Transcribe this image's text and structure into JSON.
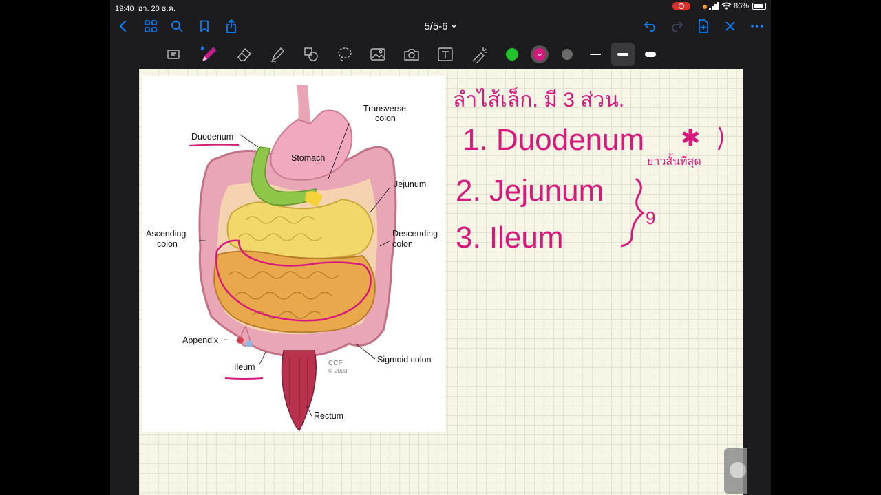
{
  "status_bar": {
    "time": "19:40",
    "date": "อา. 20 ธ.ค.",
    "battery": "86%"
  },
  "nav": {
    "title": "5/5-6",
    "accent": "#0a84ff"
  },
  "toolbar": {
    "icons": [
      "page-view-icon",
      "pen-icon",
      "eraser-icon",
      "highlighter-icon",
      "shapes-icon",
      "lasso-icon",
      "image-icon",
      "camera-icon",
      "text-icon",
      "laser-pointer-icon"
    ],
    "colors": [
      "#22c32a",
      "#d6197a",
      "#6b6b6b"
    ],
    "selected_color": "#d6197a"
  },
  "diagram": {
    "labels": {
      "transverse_colon_1": "Transverse",
      "transverse_colon_2": "colon",
      "duodenum": "Duodenum",
      "stomach": "Stomach",
      "jejunum": "Jejunum",
      "ascending_1": "Ascending",
      "ascending_2": "colon",
      "descending_1": "Descending",
      "descending_2": "colon",
      "appendix": "Appendix",
      "ileum": "Ileum",
      "sigmoid": "Sigmoid colon",
      "rectum": "Rectum",
      "ccf_1": "CCF",
      "ccf_2": "© 2003"
    }
  },
  "notes": {
    "heading": "ลำไส้เล็ก. มี 3 ส่วน.",
    "item1": "1. Duodenum",
    "item1_note": "ยาวสั้นที่สุด",
    "item2": "2. Jejunum",
    "item3": "3. Ileum",
    "brace_note": "9"
  }
}
